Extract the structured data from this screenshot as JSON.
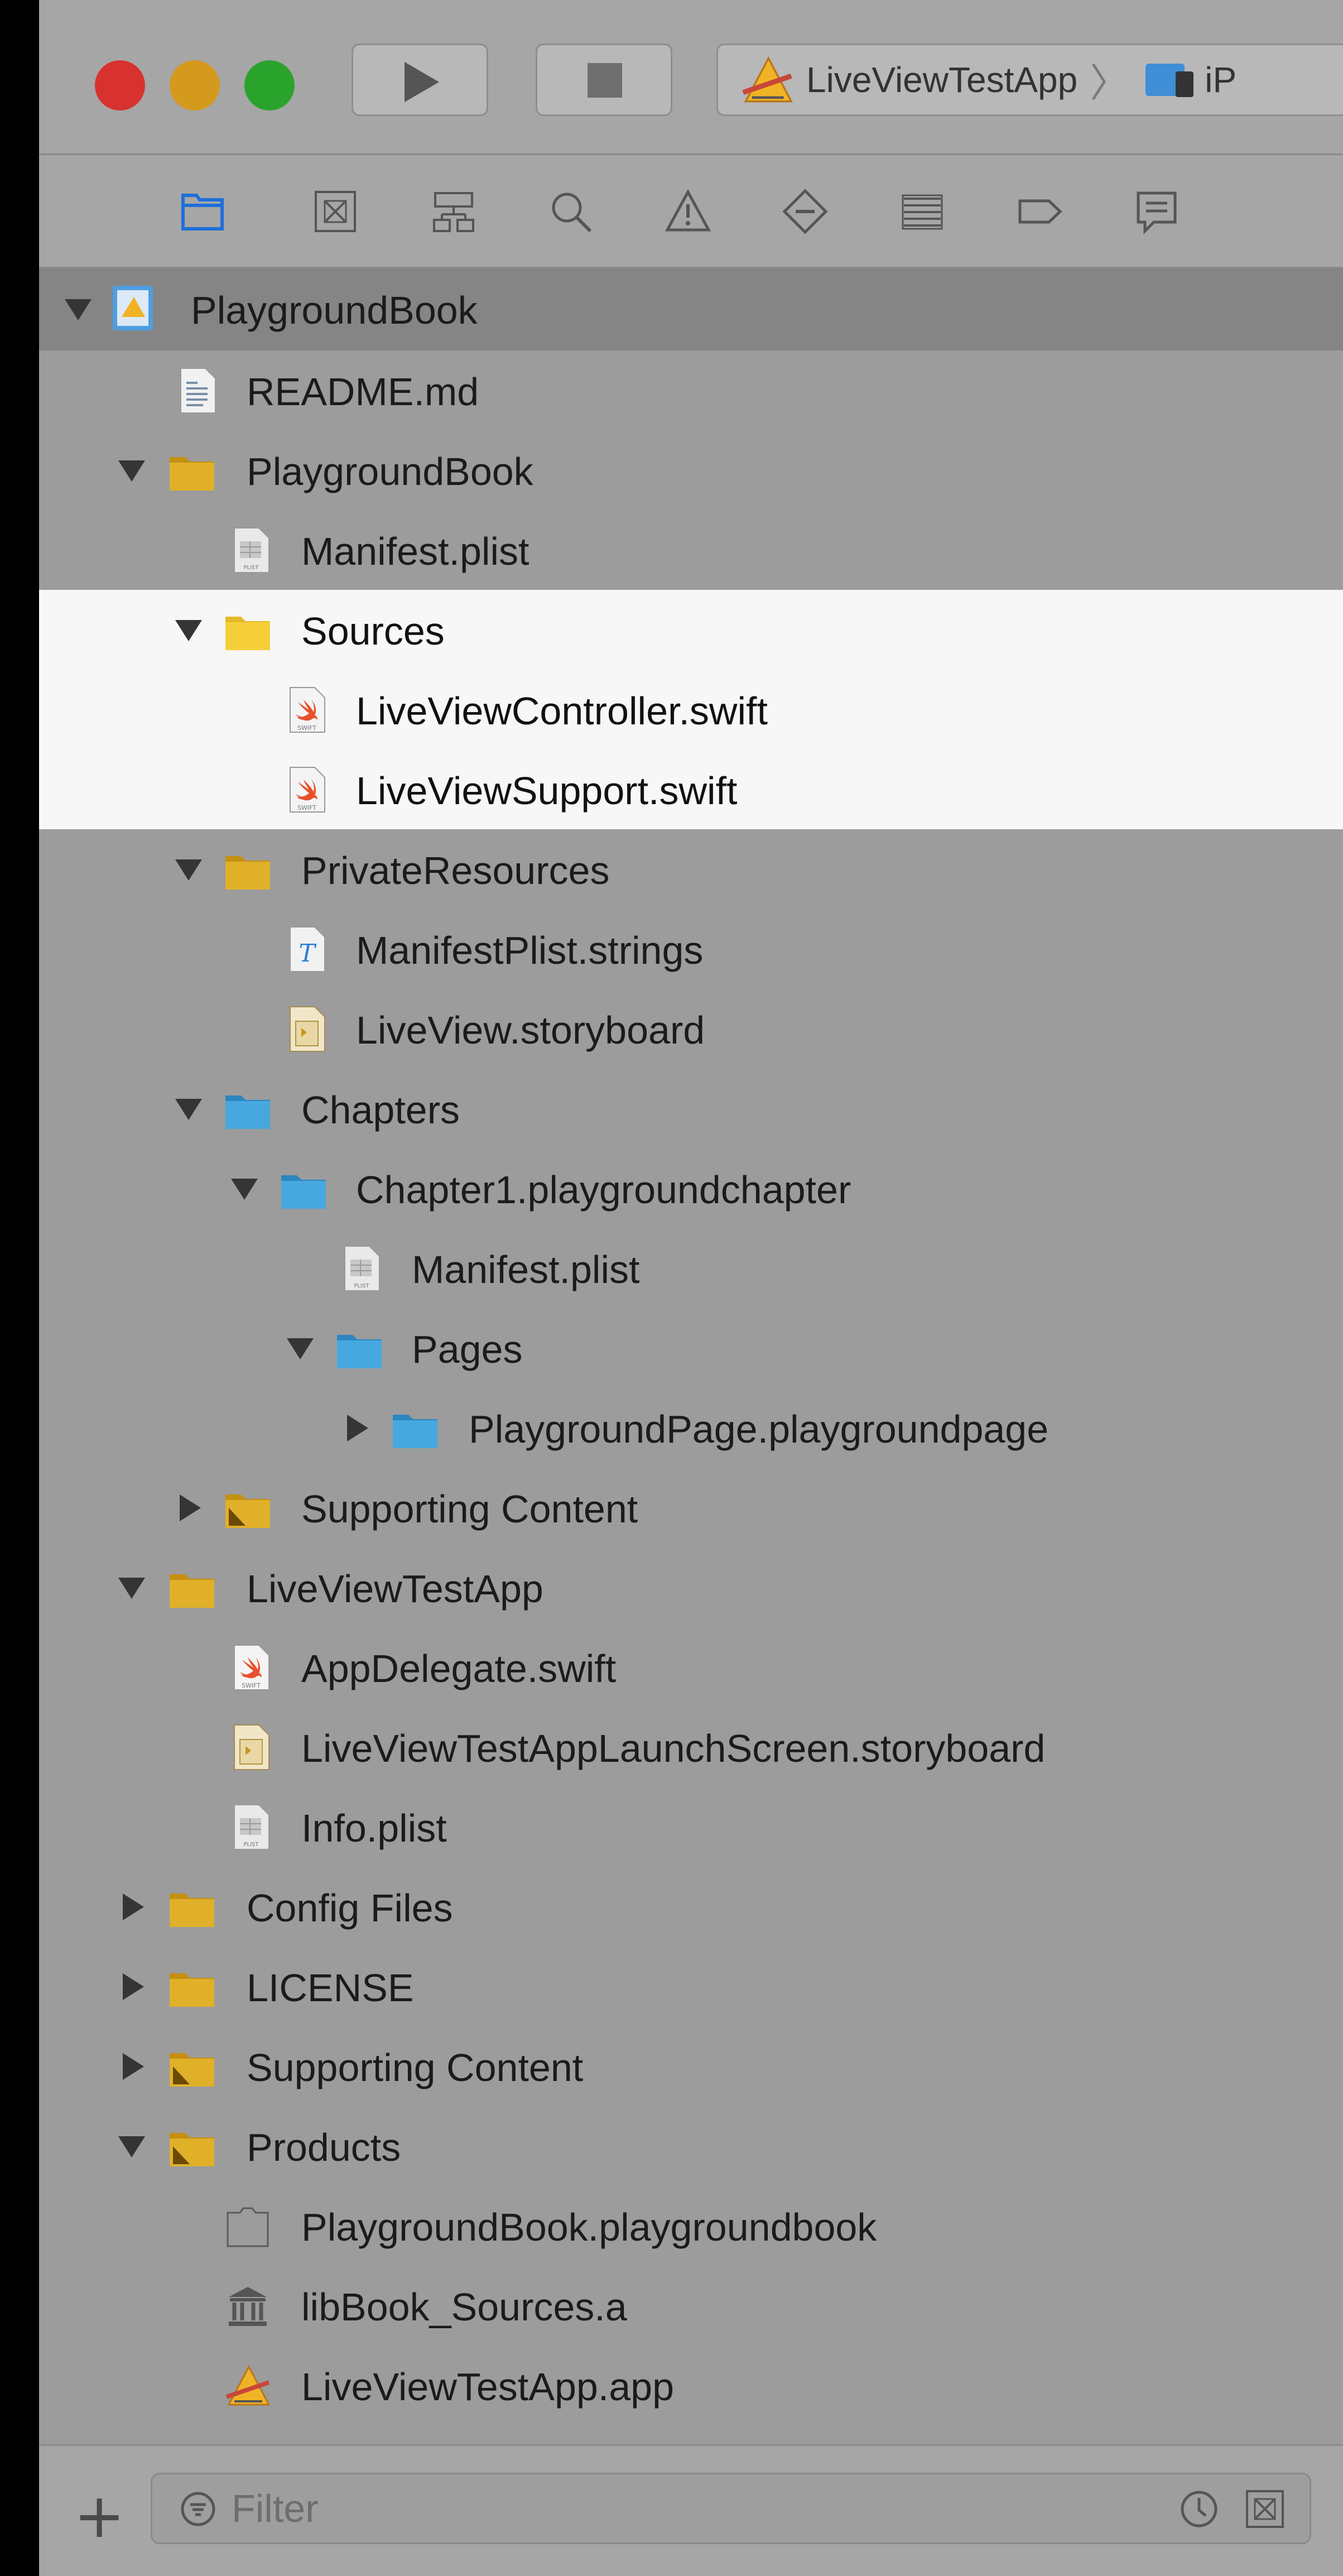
{
  "toolbar": {
    "scheme": {
      "app_name": "LiveViewTestApp",
      "separator": "〉",
      "device_partial": "iP"
    }
  },
  "navigator_tabs": [
    "project-navigator-icon",
    "source-control-icon",
    "symbol-navigator-icon",
    "find-icon",
    "issue-navigator-icon",
    "test-navigator-icon",
    "debug-navigator-icon",
    "breakpoint-icon",
    "report-icon"
  ],
  "tree": {
    "root": "PlaygroundBook",
    "readme": "README.md",
    "pb_folder": "PlaygroundBook",
    "pb_manifest": "Manifest.plist",
    "sources": "Sources",
    "live_view_controller": "LiveViewController.swift",
    "live_view_support": "LiveViewSupport.swift",
    "private_resources": "PrivateResources",
    "manifest_strings": "ManifestPlist.strings",
    "live_view_storyboard": "LiveView.storyboard",
    "chapters": "Chapters",
    "chapter1": "Chapter1.playgroundchapter",
    "chapter1_manifest": "Manifest.plist",
    "pages": "Pages",
    "playground_page": "PlaygroundPage.playgroundpage",
    "pb_supporting": "Supporting Content",
    "app_folder": "LiveViewTestApp",
    "app_delegate": "AppDelegate.swift",
    "launch_screen": "LiveViewTestAppLaunchScreen.storyboard",
    "info_plist": "Info.plist",
    "config_files": "Config Files",
    "license": "LICENSE",
    "supporting": "Supporting Content",
    "products": "Products",
    "product_book": "PlaygroundBook.playgroundbook",
    "product_lib": "libBook_Sources.a",
    "product_app": "LiveViewTestApp.app"
  },
  "filter": {
    "placeholder": "Filter"
  },
  "colors": {
    "close": "#d8322f",
    "minimize": "#d49a1d",
    "zoom": "#2aa32c",
    "selected_row": "#858585",
    "highlight_rows": "#f7f7f7",
    "yellow_folder": "#d9a51f",
    "blue_folder": "#3aa0d8",
    "accent": "#1e6fd9"
  }
}
